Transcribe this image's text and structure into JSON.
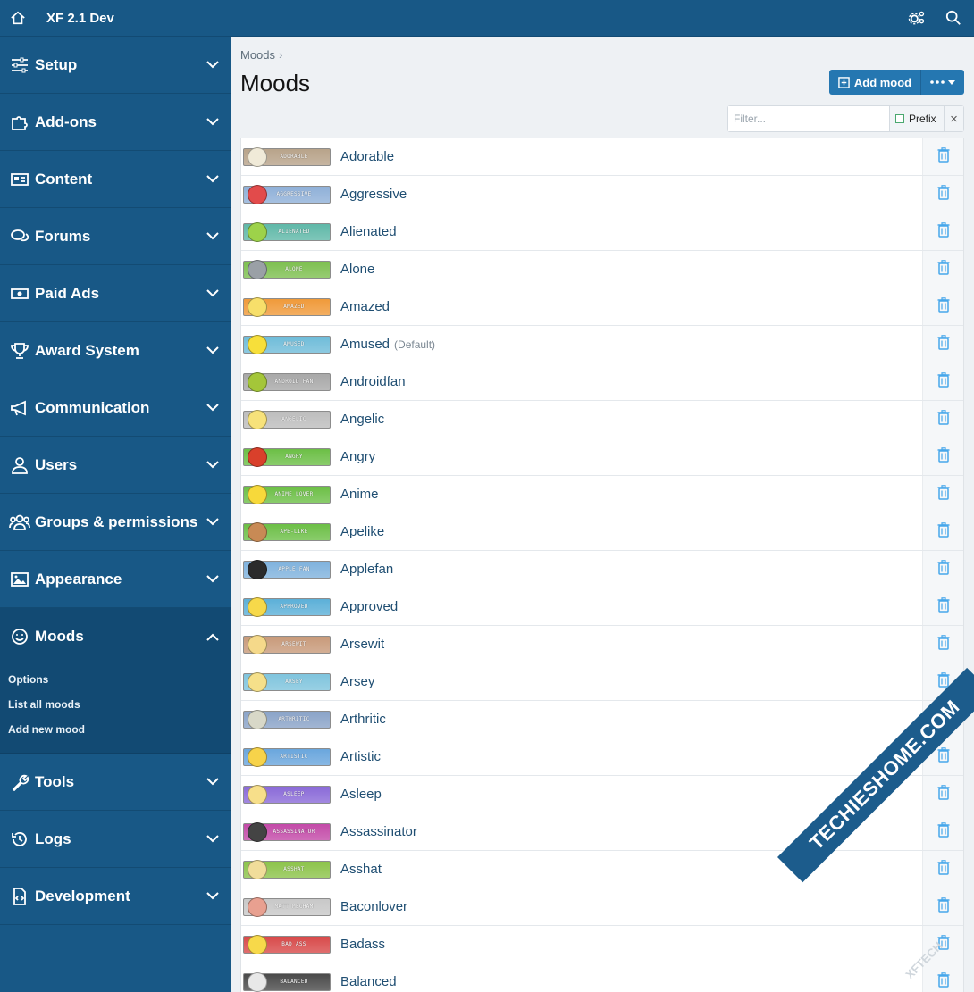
{
  "topbar": {
    "title": "XF 2.1 Dev"
  },
  "sidebar": {
    "items": [
      {
        "label": "Setup",
        "icon": "sliders-icon"
      },
      {
        "label": "Add-ons",
        "icon": "puzzle-icon"
      },
      {
        "label": "Content",
        "icon": "newspaper-icon"
      },
      {
        "label": "Forums",
        "icon": "comments-icon"
      },
      {
        "label": "Paid Ads",
        "icon": "money-icon"
      },
      {
        "label": "Award System",
        "icon": "trophy-icon"
      },
      {
        "label": "Communication",
        "icon": "megaphone-icon"
      },
      {
        "label": "Users",
        "icon": "user-icon"
      },
      {
        "label": "Groups & permissions",
        "icon": "users-icon"
      },
      {
        "label": "Appearance",
        "icon": "image-icon"
      },
      {
        "label": "Moods",
        "icon": "smile-icon"
      },
      {
        "label": "Tools",
        "icon": "wrench-icon"
      },
      {
        "label": "Logs",
        "icon": "history-icon"
      },
      {
        "label": "Development",
        "icon": "code-file-icon"
      }
    ],
    "moods_sub": [
      "Options",
      "List all moods",
      "Add new mood"
    ]
  },
  "main": {
    "breadcrumb": "Moods",
    "title": "Moods",
    "add_button": "Add mood",
    "filter_placeholder": "Filter...",
    "prefix_label": "Prefix"
  },
  "moods": [
    {
      "name": "Adorable",
      "badge": "ADORABLE",
      "color": "#b8a38a",
      "face": "#f0ead8"
    },
    {
      "name": "Aggressive",
      "badge": "AGGRESSIVE",
      "color": "#8fb0d8",
      "face": "#e24b4b"
    },
    {
      "name": "Alienated",
      "badge": "ALIENATED",
      "color": "#5fb8a8",
      "face": "#9dd24a"
    },
    {
      "name": "Alone",
      "badge": "ALONE",
      "color": "#7dbf4f",
      "face": "#9aa0a6"
    },
    {
      "name": "Amazed",
      "badge": "AMAZED",
      "color": "#f09a3a",
      "face": "#f7df6a"
    },
    {
      "name": "Amused",
      "badge": "AMUSED",
      "color": "#6fbcd9",
      "face": "#f7df3a",
      "default": "(Default)"
    },
    {
      "name": "Androidfan",
      "badge": "ANDROID FAN",
      "color": "#a8a8a8",
      "face": "#a4c639"
    },
    {
      "name": "Angelic",
      "badge": "ANGELIC",
      "color": "#bdbdbd",
      "face": "#f7e27a"
    },
    {
      "name": "Angry",
      "badge": "ANGRY",
      "color": "#6cbf46",
      "face": "#d9402b"
    },
    {
      "name": "Anime",
      "badge": "ANIME LOVER",
      "color": "#6cbf46",
      "face": "#f7d93a"
    },
    {
      "name": "Apelike",
      "badge": "APE-LIKE",
      "color": "#6cbf46",
      "face": "#c88a55"
    },
    {
      "name": "Applefan",
      "badge": "APPLE FAN",
      "color": "#7fb2dd",
      "face": "#2b2b2b"
    },
    {
      "name": "Approved",
      "badge": "APPROVED",
      "color": "#5cb0d8",
      "face": "#f7d94a"
    },
    {
      "name": "Arsewit",
      "badge": "ARSEWIT",
      "color": "#c89a7a",
      "face": "#f5d98a"
    },
    {
      "name": "Arsey",
      "badge": "ARSEY",
      "color": "#7fc4dd",
      "face": "#f5e08a"
    },
    {
      "name": "Arthritic",
      "badge": "ARTHRITIC",
      "color": "#8aa3c8",
      "face": "#d8d8c8"
    },
    {
      "name": "Artistic",
      "badge": "ARTISTIC",
      "color": "#6aa6dd",
      "face": "#f7d34a"
    },
    {
      "name": "Asleep",
      "badge": "ASLEEP",
      "color": "#8a6ad8",
      "face": "#f7df8a"
    },
    {
      "name": "Assassinator",
      "badge": "ASSASSINATOR",
      "color": "#c34aa8",
      "face": "#444444"
    },
    {
      "name": "Asshat",
      "badge": "ASSHAT",
      "color": "#8cc34a",
      "face": "#f1dd9a"
    },
    {
      "name": "Baconlover",
      "badge": "MATT MECHAM",
      "color": "#c8c8c8",
      "face": "#e8a090"
    },
    {
      "name": "Badass",
      "badge": "BAD ASS",
      "color": "#d84a4a",
      "face": "#f7d94a"
    },
    {
      "name": "Balanced",
      "badge": "BALANCED",
      "color": "#4a4a4a",
      "face": "#e8e8e8"
    }
  ],
  "watermark": {
    "main": "TECHIESHOME.COM",
    "sub": "XFTECH"
  }
}
